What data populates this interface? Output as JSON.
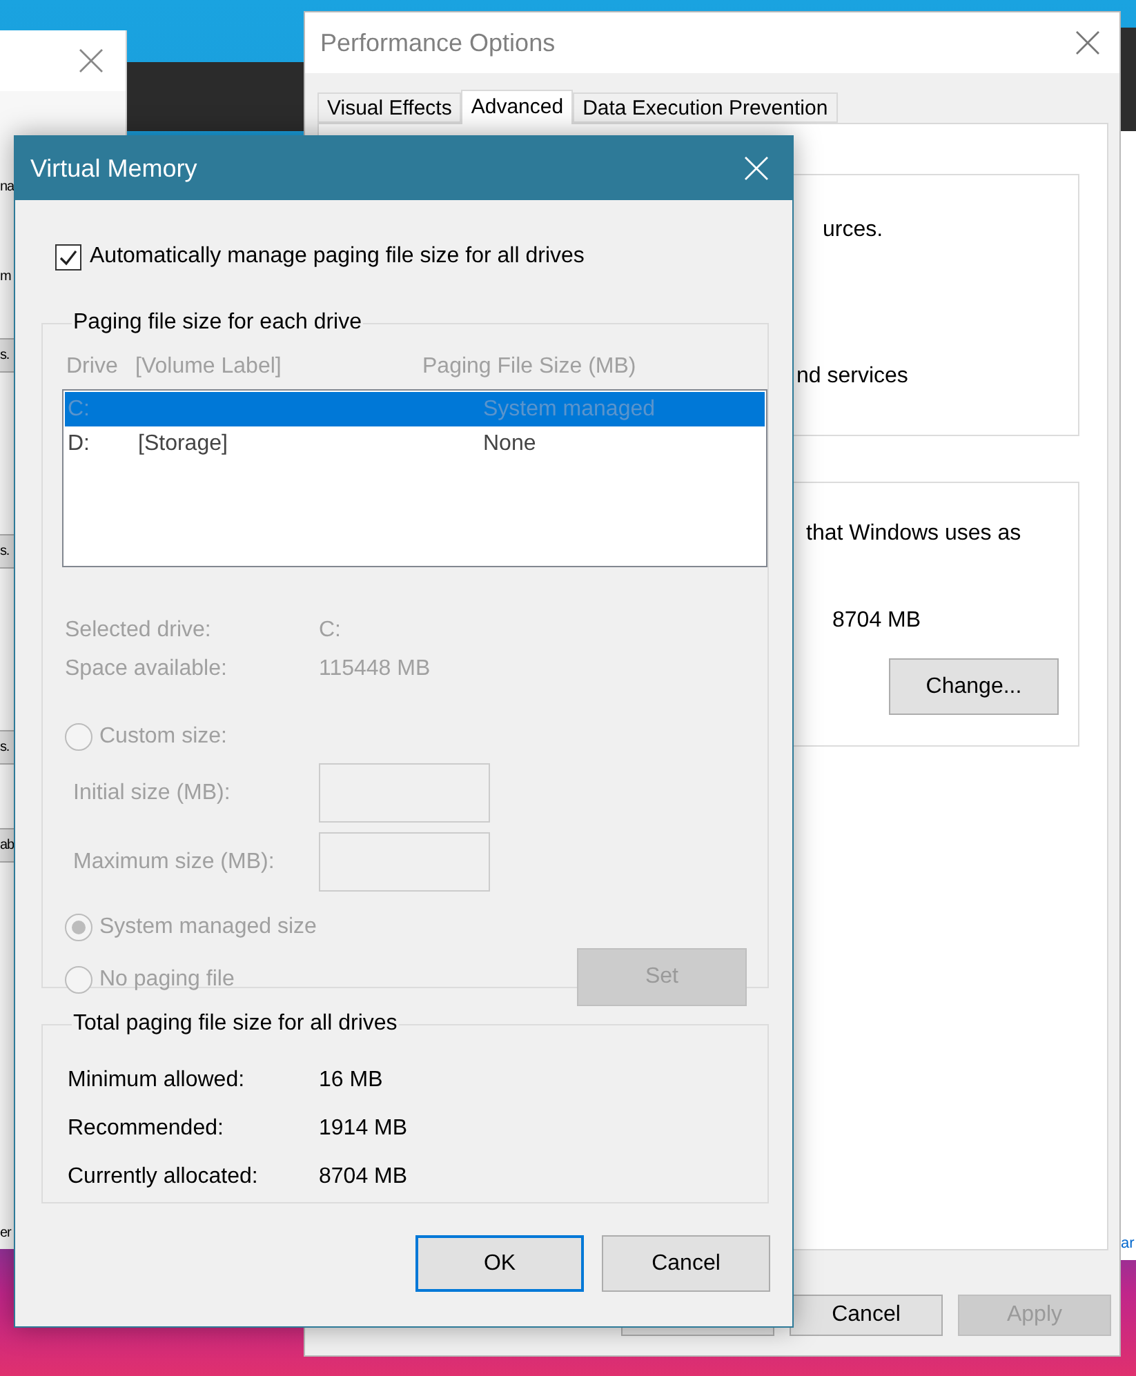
{
  "left_window": {
    "items": [
      {
        "kind": "label",
        "text": "na"
      },
      {
        "kind": "label",
        "text": "m"
      },
      {
        "kind": "button",
        "text": "s."
      },
      {
        "kind": "button",
        "text": "s."
      },
      {
        "kind": "button",
        "text": "s."
      },
      {
        "kind": "button",
        "text": "ab"
      },
      {
        "kind": "label",
        "text": "er"
      }
    ]
  },
  "right_window": {
    "items": [
      {
        "kind": "link",
        "text": "ar"
      }
    ]
  },
  "performance_options": {
    "title": "Performance Options",
    "tabs": [
      {
        "label": "Visual Effects",
        "selected": false
      },
      {
        "label": "Advanced",
        "selected": true
      },
      {
        "label": "Data Execution Prevention",
        "selected": false
      }
    ],
    "groups": [
      {
        "lines": [
          "urces.",
          "nd services"
        ]
      },
      {
        "lines": [
          "that Windows uses as"
        ],
        "value": "8704 MB",
        "button": "Change..."
      }
    ],
    "buttons": [
      {
        "label": "Cancel",
        "disabled": false
      },
      {
        "label": "Apply",
        "disabled": true
      }
    ]
  },
  "virtual_memory": {
    "title": "Virtual Memory",
    "auto_manage": {
      "label": "Automatically manage paging file size for all drives",
      "checked": true
    },
    "paging_group": {
      "title": "Paging file size for each drive",
      "disabled": true,
      "columns": [
        "Drive",
        "[Volume Label]",
        "Paging File Size (MB)"
      ],
      "rows": [
        {
          "drive": "C:",
          "size": "System managed",
          "selected": true
        },
        {
          "drive": "D:",
          "volume_label": "[Storage]",
          "size": "None",
          "selected": false
        }
      ],
      "info": [
        {
          "label": "Selected drive:",
          "value": "C:"
        },
        {
          "label": "Space available:",
          "value": "115448 MB"
        }
      ],
      "options": [
        {
          "kind": "radio",
          "label": "Custom size:",
          "selected": false
        },
        {
          "kind": "field",
          "label": "Initial size (MB):"
        },
        {
          "kind": "field",
          "label": "Maximum size (MB):"
        },
        {
          "kind": "radio",
          "label": "System managed size",
          "selected": true
        },
        {
          "kind": "radio",
          "label": "No paging file",
          "selected": false
        }
      ],
      "set_button": {
        "label": "Set",
        "disabled": true
      }
    },
    "totals": {
      "title": "Total paging file size for all drives",
      "rows": [
        {
          "label": "Minimum allowed:",
          "value": "16 MB"
        },
        {
          "label": "Recommended:",
          "value": "1914 MB"
        },
        {
          "label": "Currently allocated:",
          "value": "8704 MB"
        }
      ]
    },
    "buttons": [
      {
        "label": "OK",
        "default": true
      },
      {
        "label": "Cancel",
        "default": false
      }
    ]
  }
}
